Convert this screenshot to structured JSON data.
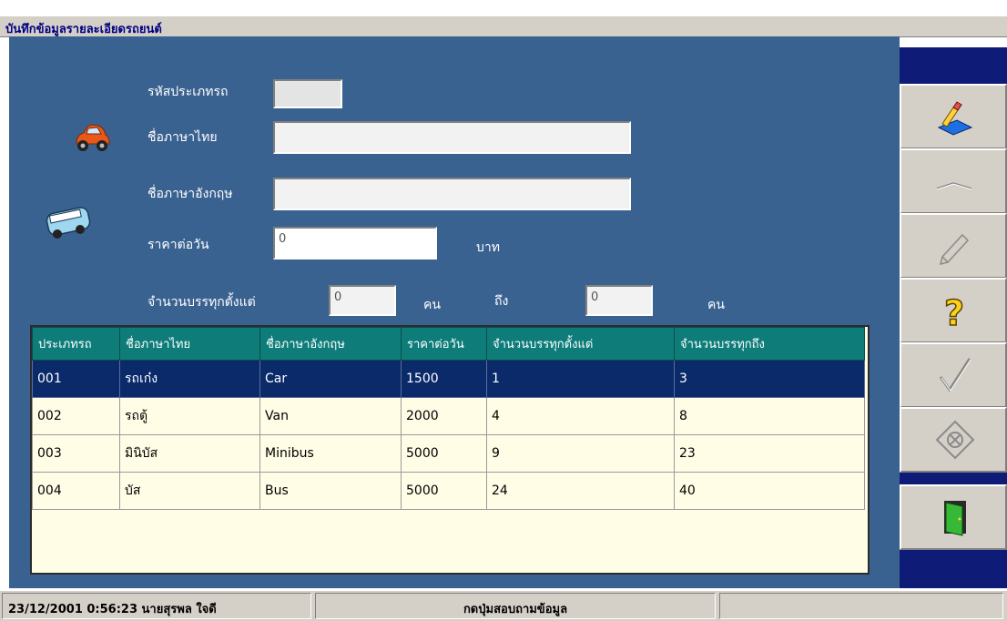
{
  "window": {
    "title": "บันทึกข้อมูลรายละเอียดรถยนต์"
  },
  "form": {
    "type_code_label": "รหัสประเภทรถ",
    "type_code_value": "",
    "thai_name_label": "ชื่อภาษาไทย",
    "thai_name_value": "",
    "eng_name_label": "ชื่อภาษาอังกฤษ",
    "eng_name_value": "",
    "price_label": "ราคาต่อวัน",
    "price_value": "0",
    "price_unit": "บาท",
    "capacity_label": "จำนวนบรรทุกตั้งแต่",
    "capacity_from": "0",
    "capacity_unit1": "คน",
    "capacity_to_label": "ถึง",
    "capacity_to": "0",
    "capacity_unit2": "คน"
  },
  "table": {
    "columns": [
      "ประเภทรถ",
      "ชื่อภาษาไทย",
      "ชื่อภาษาอังกฤษ",
      "ราคาต่อวัน",
      "จำนวนบรรทุกตั้งแต่",
      "จำนวนบรรทุกถึง"
    ],
    "rows": [
      [
        "001",
        "รถเก๋ง",
        "Car",
        "1500",
        "1",
        "3"
      ],
      [
        "002",
        "รถตู้",
        "Van",
        "2000",
        "4",
        "8"
      ],
      [
        "003",
        "มินิบัส",
        "Minibus",
        "5000",
        "9",
        "23"
      ],
      [
        "004",
        "บัส",
        "Bus",
        "5000",
        "24",
        "40"
      ]
    ],
    "selected_row": 0
  },
  "toolbar": {
    "buttons": [
      "edit-icon",
      "blank-icon",
      "pencil-icon",
      "help-icon",
      "check-icon",
      "cancel-icon",
      "exit-door-icon"
    ]
  },
  "status": {
    "datetime_user": "23/12/2001 0:56:23 นายสุรพล ใจดี",
    "message": "กดปุ่มสอบถามข้อมูล",
    "extra": ""
  },
  "colors": {
    "form_bg": "#3a6290",
    "header_bg": "#0e7d7a",
    "selected_row": "#0a2a6a",
    "toolbar_bg": "#0e1c78"
  }
}
